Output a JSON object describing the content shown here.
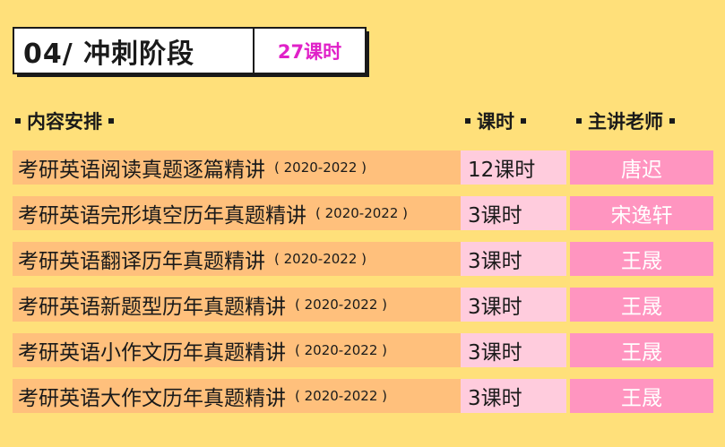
{
  "header": {
    "stage_title": "04/ 冲刺阶段",
    "stage_hours": "27课时"
  },
  "columns": {
    "content": "内容安排",
    "hours": "课时",
    "teacher": "主讲老师"
  },
  "rows": [
    {
      "course": "考研英语阅读真题逐篇精讲",
      "years": "( 2020-2022 )",
      "hours": "12课时",
      "teacher": "唐迟"
    },
    {
      "course": "考研英语完形填空历年真题精讲",
      "years": "( 2020-2022 )",
      "hours": "3课时",
      "teacher": "宋逸轩"
    },
    {
      "course": "考研英语翻译历年真题精讲",
      "years": "( 2020-2022 )",
      "hours": "3课时",
      "teacher": "王晟"
    },
    {
      "course": "考研英语新题型历年真题精讲",
      "years": "( 2020-2022 )",
      "hours": "3课时",
      "teacher": "王晟"
    },
    {
      "course": "考研英语小作文历年真题精讲",
      "years": "( 2020-2022 )",
      "hours": "3课时",
      "teacher": "王晟"
    },
    {
      "course": "考研英语大作文历年真题精讲",
      "years": "( 2020-2022 )",
      "hours": "3课时",
      "teacher": "王晟"
    }
  ],
  "colors": {
    "background": "#FFE07A",
    "course_cell": "#FFC07C",
    "hours_cell": "#FFCCDD",
    "teacher_cell": "#FF95C0",
    "accent": "#E021C8"
  }
}
